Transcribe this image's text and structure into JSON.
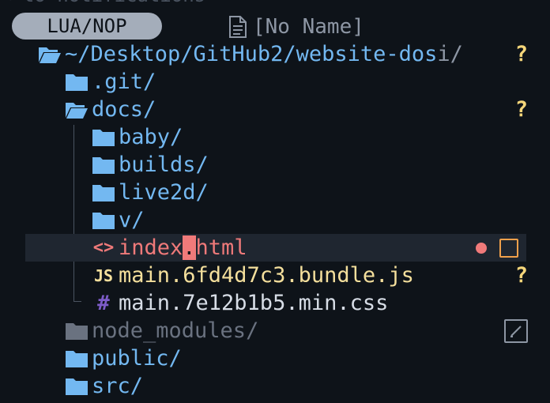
{
  "notification_hint": "< to notifications",
  "tabline": {
    "mode": "LUA/NOP",
    "buffer_name": "[No Name]"
  },
  "tree": {
    "root": {
      "label": "~/Desktop/GitHub2/website-dos",
      "trail": "i/",
      "status": "?"
    },
    "git": {
      "label": ".git/"
    },
    "docs": {
      "label": "docs/",
      "status": "?"
    },
    "baby": {
      "label": "baby/"
    },
    "builds": {
      "label": "builds/"
    },
    "live2d": {
      "label": "live2d/"
    },
    "v": {
      "label": "v/"
    },
    "index_html": {
      "before_cursor": "index",
      "cursor_char": ".",
      "after_cursor": "html",
      "icon_glyph": "<>"
    },
    "main_js": {
      "label": "main.6fd4d7c3.bundle.js",
      "icon_glyph": "JS",
      "status": "?"
    },
    "main_css": {
      "label": "main.7e12b1b5.min.css",
      "icon_glyph": "#"
    },
    "node_modules": {
      "label": "node_modules/"
    },
    "public": {
      "label": "public/"
    },
    "src": {
      "label": "src/"
    }
  },
  "colors": {
    "background": "#0e1319",
    "directory": "#73b8f1",
    "modified": "#f07a7a",
    "untracked": "#f5d67a",
    "ignored": "#6a7280",
    "cursorline": "#1f2630"
  }
}
